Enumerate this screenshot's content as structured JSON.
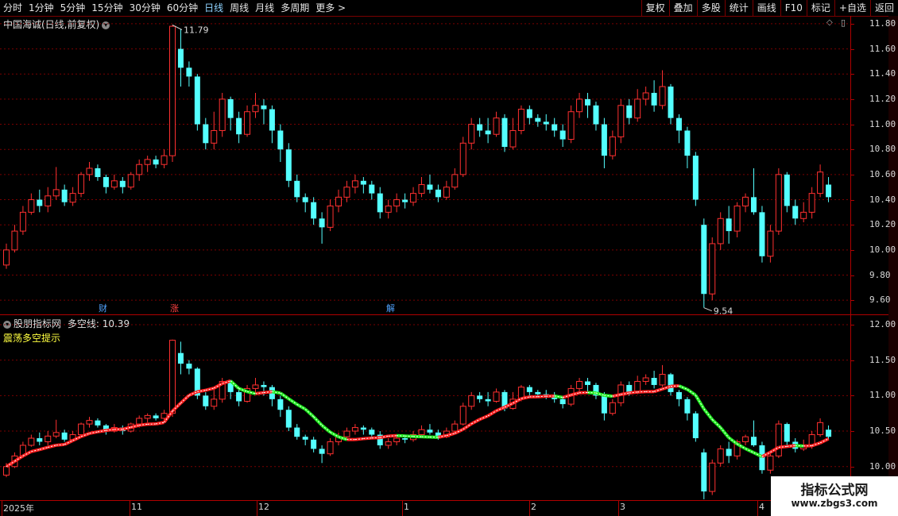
{
  "toolbar": {
    "periods": [
      "分时",
      "1分钟",
      "5分钟",
      "15分钟",
      "30分钟",
      "60分钟",
      "日线",
      "周线",
      "月线",
      "多周期",
      "更多 >"
    ],
    "active_period": "日线",
    "right_buttons": [
      "复权",
      "叠加",
      "多股",
      "统计",
      "画线",
      "F10",
      "标记",
      "+自选",
      "返回"
    ]
  },
  "main_pane": {
    "title": "中国海诚(日线,前复权)",
    "high_label": "11.79",
    "low_label": "9.54",
    "y_ticks": [
      "11.80",
      "11.60",
      "11.40",
      "11.20",
      "11.00",
      "10.80",
      "10.60",
      "10.40",
      "10.20",
      "10.00",
      "9.80",
      "9.60"
    ],
    "events": [
      {
        "text": "财",
        "color": "#4fa3ff"
      },
      {
        "text": "涨",
        "color": "#ff4040"
      },
      {
        "text": "解",
        "color": "#4fa3ff"
      }
    ]
  },
  "sub_pane": {
    "title": "股朋指标网",
    "line_label": "多空线:",
    "line_value": "10.39",
    "subtitle": "震荡多空提示",
    "y_ticks": [
      "12.00",
      "11.50",
      "11.00",
      "10.50",
      "10.00"
    ]
  },
  "x_axis": {
    "labels": [
      "2025年",
      "11",
      "12",
      "1",
      "2",
      "3",
      "4"
    ]
  },
  "watermark": {
    "line1": "指标公式网",
    "line2": "www.zbgs3.com"
  },
  "colors": {
    "up": "#ff3030",
    "down": "#54ffff",
    "bull_line": "#ff2020",
    "bear_line": "#22ee22",
    "grid": "#b00000",
    "axis": "#b00000"
  },
  "icons": [
    "chevron-down-icon",
    "diamond-icon",
    "pane-toggle-icon"
  ],
  "chart_data": [
    {
      "type": "candlestick",
      "title": "中国海诚(日线,前复权)",
      "y_range": [
        9.5,
        11.85
      ],
      "high": 11.79,
      "low": 9.54,
      "x_labels": [
        "2025年",
        "11",
        "12",
        "1",
        "2",
        "3",
        "4"
      ],
      "candles": [
        [
          9.88,
          10.0,
          10.05,
          9.85
        ],
        [
          10.0,
          10.15,
          10.2,
          9.98
        ],
        [
          10.15,
          10.3,
          10.35,
          10.12
        ],
        [
          10.3,
          10.4,
          10.45,
          10.28
        ],
        [
          10.4,
          10.35,
          10.48,
          10.3
        ],
        [
          10.35,
          10.43,
          10.5,
          10.3
        ],
        [
          10.43,
          10.48,
          10.66,
          10.4
        ],
        [
          10.48,
          10.38,
          10.52,
          10.35
        ],
        [
          10.38,
          10.45,
          10.5,
          10.35
        ],
        [
          10.45,
          10.6,
          10.62,
          10.42
        ],
        [
          10.6,
          10.65,
          10.7,
          10.55
        ],
        [
          10.65,
          10.58,
          10.68,
          10.55
        ],
        [
          10.58,
          10.5,
          10.6,
          10.45
        ],
        [
          10.5,
          10.55,
          10.6,
          10.48
        ],
        [
          10.55,
          10.5,
          10.58,
          10.45
        ],
        [
          10.5,
          10.6,
          10.62,
          10.48
        ],
        [
          10.6,
          10.68,
          10.72,
          10.55
        ],
        [
          10.68,
          10.72,
          10.75,
          10.62
        ],
        [
          10.72,
          10.68,
          10.75,
          10.65
        ],
        [
          10.68,
          10.75,
          10.8,
          10.65
        ],
        [
          10.75,
          11.78,
          11.79,
          10.7
        ],
        [
          11.6,
          11.45,
          11.76,
          11.3
        ],
        [
          11.45,
          11.38,
          11.5,
          11.3
        ],
        [
          11.38,
          11.0,
          11.4,
          10.95
        ],
        [
          11.0,
          10.85,
          11.05,
          10.8
        ],
        [
          10.85,
          10.95,
          11.1,
          10.8
        ],
        [
          10.95,
          11.2,
          11.25,
          10.9
        ],
        [
          11.2,
          11.05,
          11.22,
          10.95
        ],
        [
          11.05,
          10.92,
          11.1,
          10.85
        ],
        [
          10.92,
          11.1,
          11.15,
          10.9
        ],
        [
          11.1,
          11.15,
          11.25,
          11.05
        ],
        [
          11.15,
          11.12,
          11.2,
          11.0
        ],
        [
          11.12,
          10.95,
          11.15,
          10.85
        ],
        [
          10.95,
          10.8,
          11.0,
          10.7
        ],
        [
          10.8,
          10.55,
          10.85,
          10.5
        ],
        [
          10.55,
          10.42,
          10.6,
          10.38
        ],
        [
          10.42,
          10.38,
          10.45,
          10.3
        ],
        [
          10.38,
          10.25,
          10.42,
          10.2
        ],
        [
          10.25,
          10.18,
          10.3,
          10.05
        ],
        [
          10.18,
          10.35,
          10.4,
          10.15
        ],
        [
          10.35,
          10.42,
          10.48,
          10.3
        ],
        [
          10.42,
          10.5,
          10.55,
          10.38
        ],
        [
          10.5,
          10.55,
          10.6,
          10.45
        ],
        [
          10.55,
          10.52,
          10.58,
          10.45
        ],
        [
          10.52,
          10.45,
          10.55,
          10.4
        ],
        [
          10.45,
          10.3,
          10.5,
          10.25
        ],
        [
          10.3,
          10.35,
          10.4,
          10.25
        ],
        [
          10.35,
          10.4,
          10.45,
          10.3
        ],
        [
          10.4,
          10.38,
          10.45,
          10.33
        ],
        [
          10.38,
          10.45,
          10.5,
          10.35
        ],
        [
          10.45,
          10.52,
          10.58,
          10.42
        ],
        [
          10.52,
          10.48,
          10.6,
          10.45
        ],
        [
          10.48,
          10.42,
          10.52,
          10.38
        ],
        [
          10.42,
          10.5,
          10.55,
          10.4
        ],
        [
          10.5,
          10.6,
          10.65,
          10.48
        ],
        [
          10.6,
          10.85,
          10.9,
          10.58
        ],
        [
          10.85,
          11.0,
          11.05,
          10.8
        ],
        [
          11.0,
          10.95,
          11.05,
          10.9
        ],
        [
          10.95,
          10.92,
          11.05,
          10.85
        ],
        [
          10.92,
          11.05,
          11.1,
          10.9
        ],
        [
          11.05,
          10.82,
          11.08,
          10.78
        ],
        [
          10.82,
          10.95,
          11.05,
          10.8
        ],
        [
          10.95,
          11.12,
          11.15,
          10.92
        ],
        [
          11.12,
          11.05,
          11.15,
          11.0
        ],
        [
          11.05,
          11.02,
          11.08,
          10.98
        ],
        [
          11.02,
          11.0,
          11.08,
          10.95
        ],
        [
          11.0,
          10.95,
          11.05,
          10.9
        ],
        [
          10.95,
          10.88,
          11.0,
          10.82
        ],
        [
          10.88,
          11.1,
          11.15,
          10.85
        ],
        [
          11.1,
          11.2,
          11.25,
          11.05
        ],
        [
          11.2,
          11.15,
          11.25,
          11.05
        ],
        [
          11.15,
          11.0,
          11.18,
          10.95
        ],
        [
          11.0,
          10.75,
          11.05,
          10.65
        ],
        [
          10.75,
          10.9,
          10.95,
          10.72
        ],
        [
          10.9,
          11.15,
          11.2,
          10.85
        ],
        [
          11.15,
          11.05,
          11.2,
          11.0
        ],
        [
          11.05,
          11.2,
          11.28,
          11.02
        ],
        [
          11.2,
          11.25,
          11.3,
          11.15
        ],
        [
          11.25,
          11.15,
          11.35,
          11.1
        ],
        [
          11.15,
          11.3,
          11.43,
          11.12
        ],
        [
          11.3,
          11.05,
          11.32,
          11.0
        ],
        [
          11.05,
          10.95,
          11.08,
          10.85
        ],
        [
          10.95,
          10.75,
          10.98,
          10.65
        ],
        [
          10.75,
          10.4,
          10.78,
          10.35
        ],
        [
          10.2,
          9.65,
          10.25,
          9.54
        ],
        [
          9.65,
          10.05,
          10.1,
          9.6
        ],
        [
          10.05,
          10.25,
          10.3,
          10.0
        ],
        [
          10.25,
          10.15,
          10.35,
          10.05
        ],
        [
          10.15,
          10.35,
          10.38,
          10.1
        ],
        [
          10.35,
          10.42,
          10.45,
          10.3
        ],
        [
          10.42,
          10.3,
          10.65,
          10.28
        ],
        [
          10.3,
          9.95,
          10.35,
          9.9
        ],
        [
          9.95,
          10.15,
          10.2,
          9.9
        ],
        [
          10.15,
          10.6,
          10.65,
          10.12
        ],
        [
          10.6,
          10.35,
          10.62,
          10.3
        ],
        [
          10.35,
          10.25,
          10.4,
          10.2
        ],
        [
          10.25,
          10.3,
          10.38,
          10.22
        ],
        [
          10.3,
          10.45,
          10.5,
          10.25
        ],
        [
          10.45,
          10.62,
          10.68,
          10.42
        ],
        [
          10.52,
          10.42,
          10.58,
          10.38
        ]
      ]
    },
    {
      "type": "line",
      "title": "股朋指标网",
      "series": [
        {
          "name": "多空线",
          "last": 10.39
        }
      ],
      "y_range": [
        9.55,
        12.1
      ],
      "ytick_values": [
        12.0,
        11.5,
        11.0,
        10.5,
        10.0
      ]
    }
  ]
}
